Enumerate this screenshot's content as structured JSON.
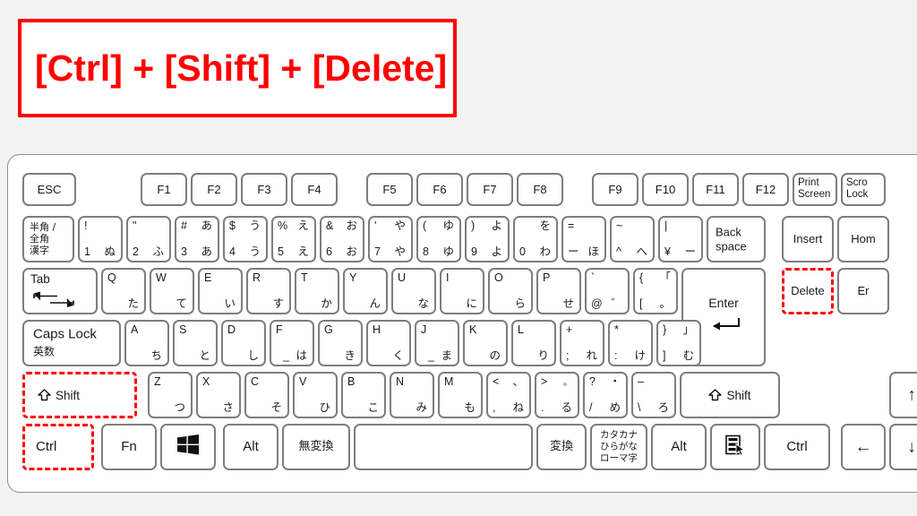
{
  "banner": {
    "text": "[Ctrl] + [Shift] + [Delete]",
    "border_color": "#ff0000",
    "text_color": "#ff0000",
    "background": "#ffffff"
  },
  "page": {
    "background": "#f2f2f2",
    "highlight_color": "#ff0000"
  },
  "keyboard": {
    "layout": "Japanese JIS 109-key (cropped at right edge)",
    "body_color": "#ffffff",
    "key_border_color": "#7d7d7d",
    "rows": [
      {
        "name": "function-row",
        "keys": [
          {
            "id": "esc",
            "main": "ESC"
          },
          {
            "id": "f1",
            "main": "F1"
          },
          {
            "id": "f2",
            "main": "F2"
          },
          {
            "id": "f3",
            "main": "F3"
          },
          {
            "id": "f4",
            "main": "F4"
          },
          {
            "id": "f5",
            "main": "F5"
          },
          {
            "id": "f6",
            "main": "F6"
          },
          {
            "id": "f7",
            "main": "F7"
          },
          {
            "id": "f8",
            "main": "F8"
          },
          {
            "id": "f9",
            "main": "F9"
          },
          {
            "id": "f10",
            "main": "F10"
          },
          {
            "id": "f11",
            "main": "F11"
          },
          {
            "id": "f12",
            "main": "F12"
          },
          {
            "id": "print-screen",
            "line1": "Print",
            "line2": "Screen"
          },
          {
            "id": "scroll-lock",
            "line1": "Scro",
            "line2": "Lock"
          }
        ]
      },
      {
        "name": "number-row",
        "keys": [
          {
            "id": "hankaku-zenkaku",
            "line1": "半角 /",
            "line2": "全角",
            "line3": "漢字"
          },
          {
            "id": "digit-1",
            "tl": "!",
            "bl": "1",
            "br": "ぬ"
          },
          {
            "id": "digit-2",
            "tl": "\"",
            "bl": "2",
            "br": "ふ"
          },
          {
            "id": "digit-3",
            "tl": "#",
            "bl": "3",
            "tr": "あ",
            "br": "あ"
          },
          {
            "id": "digit-4",
            "tl": "$",
            "bl": "4",
            "tr": "う",
            "br": "う"
          },
          {
            "id": "digit-5",
            "tl": "%",
            "bl": "5",
            "tr": "え",
            "br": "え"
          },
          {
            "id": "digit-6",
            "tl": "&",
            "bl": "6",
            "tr": "お",
            "br": "お"
          },
          {
            "id": "digit-7",
            "tl": "'",
            "bl": "7",
            "tr": "や",
            "br": "や"
          },
          {
            "id": "digit-8",
            "tl": "(",
            "bl": "8",
            "tr": "ゆ",
            "br": "ゆ"
          },
          {
            "id": "digit-9",
            "tl": ")",
            "bl": "9",
            "tr": "よ",
            "br": "よ"
          },
          {
            "id": "digit-0",
            "bl": "0",
            "tr": "を",
            "br": "わ"
          },
          {
            "id": "minus",
            "tl": "=",
            "bl": "ー",
            "br": "ほ"
          },
          {
            "id": "caret",
            "tl": "~",
            "bl": "^",
            "br": "へ"
          },
          {
            "id": "yen",
            "tl": "|",
            "bl": "¥",
            "br": "ー"
          },
          {
            "id": "backspace",
            "line1": "Back",
            "line2": "space"
          },
          {
            "id": "insert",
            "main": "Insert"
          },
          {
            "id": "home",
            "main": "Hom"
          }
        ]
      },
      {
        "name": "qwerty-row",
        "keys": [
          {
            "id": "tab",
            "main": "Tab",
            "icon": "tab-arrows-icon"
          },
          {
            "id": "key-q",
            "tl": "Q",
            "br": "た"
          },
          {
            "id": "key-w",
            "tl": "W",
            "br": "て"
          },
          {
            "id": "key-e",
            "tl": "E",
            "br": "い"
          },
          {
            "id": "key-r",
            "tl": "R",
            "br": "す"
          },
          {
            "id": "key-t",
            "tl": "T",
            "br": "か"
          },
          {
            "id": "key-y",
            "tl": "Y",
            "br": "ん"
          },
          {
            "id": "key-u",
            "tl": "U",
            "br": "な"
          },
          {
            "id": "key-i",
            "tl": "I",
            "br": "に"
          },
          {
            "id": "key-o",
            "tl": "O",
            "br": "ら"
          },
          {
            "id": "key-p",
            "tl": "P",
            "br": "せ"
          },
          {
            "id": "at",
            "tl": "`",
            "bl": "@",
            "br": "゛"
          },
          {
            "id": "bracket-left",
            "tl": "{",
            "bl": "[",
            "tr": "「",
            "br": "。"
          },
          {
            "id": "enter",
            "main": "Enter",
            "icon": "enter-arrow-icon"
          },
          {
            "id": "delete",
            "main": "Delete",
            "highlight": true
          },
          {
            "id": "end",
            "main": "Er"
          }
        ]
      },
      {
        "name": "home-row",
        "keys": [
          {
            "id": "caps-lock",
            "line1": "Caps Lock",
            "line2": "英数"
          },
          {
            "id": "key-a",
            "tl": "A",
            "br": "ち"
          },
          {
            "id": "key-s",
            "tl": "S",
            "br": "と"
          },
          {
            "id": "key-d",
            "tl": "D",
            "br": "し"
          },
          {
            "id": "key-f",
            "tl": "F",
            "bl2": "_",
            "br": "は"
          },
          {
            "id": "key-g",
            "tl": "G",
            "br": "き"
          },
          {
            "id": "key-h",
            "tl": "H",
            "br": "く"
          },
          {
            "id": "key-j",
            "tl": "J",
            "bl2": "_",
            "br": "ま"
          },
          {
            "id": "key-k",
            "tl": "K",
            "br": "の"
          },
          {
            "id": "key-l",
            "tl": "L",
            "br": "り"
          },
          {
            "id": "semicolon",
            "tl": "+",
            "bl": ";",
            "br": "れ"
          },
          {
            "id": "colon",
            "tl": "*",
            "bl": ":",
            "br": "け"
          },
          {
            "id": "bracket-right",
            "tl": "}",
            "bl": "]",
            "tr": "」",
            "br": "む"
          }
        ]
      },
      {
        "name": "shift-row",
        "keys": [
          {
            "id": "shift-left",
            "main": "Shift",
            "icon": "shift-up-arrow-icon",
            "highlight": true
          },
          {
            "id": "key-z",
            "tl": "Z",
            "br": "つ"
          },
          {
            "id": "key-x",
            "tl": "X",
            "br": "さ"
          },
          {
            "id": "key-c",
            "tl": "C",
            "br": "そ"
          },
          {
            "id": "key-v",
            "tl": "V",
            "br": "ひ"
          },
          {
            "id": "key-b",
            "tl": "B",
            "br": "こ"
          },
          {
            "id": "key-n",
            "tl": "N",
            "br": "み"
          },
          {
            "id": "key-m",
            "tl": "M",
            "br": "も"
          },
          {
            "id": "comma",
            "tl": "<",
            "bl": ",",
            "tr": "、",
            "br": "ね"
          },
          {
            "id": "period",
            "tl": ">",
            "bl": ".",
            "tr": "。",
            "br": "る"
          },
          {
            "id": "slash",
            "tl": "?",
            "bl": "/",
            "tr": "・",
            "br": "め"
          },
          {
            "id": "backslash-ro",
            "tl": "–",
            "bl": "\\",
            "br": "ろ"
          },
          {
            "id": "shift-right",
            "main": "Shift",
            "icon": "shift-up-arrow-icon"
          },
          {
            "id": "arrow-up",
            "main": "↑"
          }
        ]
      },
      {
        "name": "bottom-row",
        "keys": [
          {
            "id": "ctrl-left",
            "main": "Ctrl",
            "highlight": true
          },
          {
            "id": "fn",
            "main": "Fn"
          },
          {
            "id": "windows",
            "icon": "windows-logo-icon"
          },
          {
            "id": "alt-left",
            "main": "Alt"
          },
          {
            "id": "muhenkan",
            "main": "無変換"
          },
          {
            "id": "space",
            "main": ""
          },
          {
            "id": "henkan",
            "main": "変換"
          },
          {
            "id": "kana",
            "line1": "カタカナ",
            "line2": "ひらがな",
            "line3": "ローマ字"
          },
          {
            "id": "alt-right",
            "main": "Alt"
          },
          {
            "id": "menu",
            "icon": "context-menu-icon"
          },
          {
            "id": "ctrl-right",
            "main": "Ctrl"
          },
          {
            "id": "arrow-left",
            "main": "←"
          },
          {
            "id": "arrow-down",
            "main": "↓"
          }
        ]
      }
    ]
  }
}
